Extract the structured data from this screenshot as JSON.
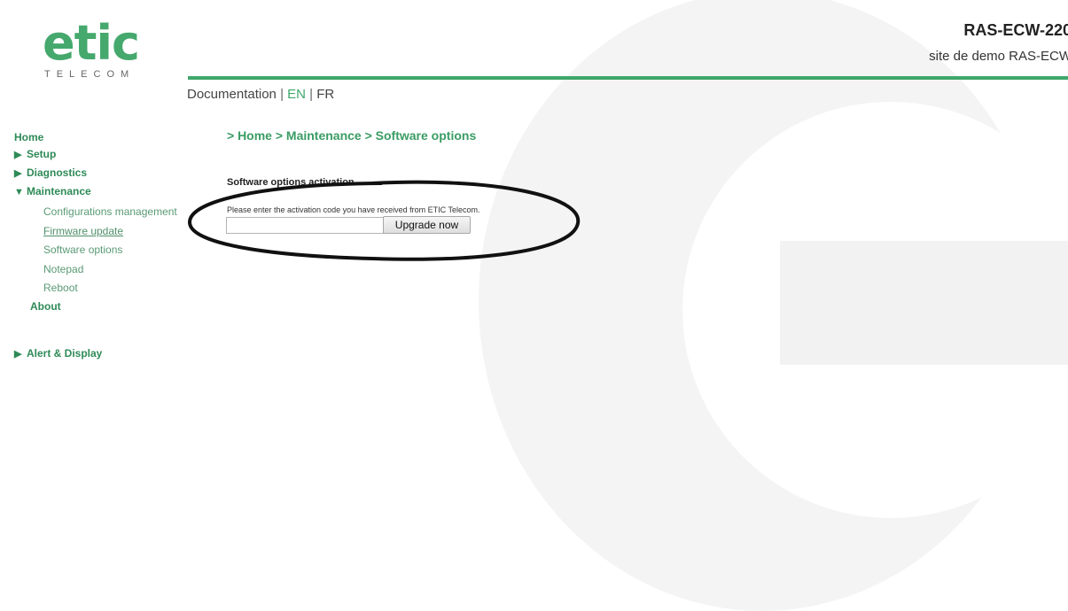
{
  "logo": {
    "word": "etic",
    "subtitle": "TELECOM"
  },
  "header": {
    "device_name": "RAS-ECW-220",
    "site_name": "site de demo RAS-ECW",
    "doc_link": "Documentation",
    "sep1": "|",
    "lang_en": "EN",
    "sep2": "|",
    "lang_fr": "FR"
  },
  "sidebar": {
    "home": "Home",
    "setup": "Setup",
    "diagnostics": "Diagnostics",
    "maintenance": "Maintenance",
    "maintenance_items": [
      "Configurations management",
      "Firmware update",
      "Software options",
      "Notepad",
      "Reboot"
    ],
    "about": "About",
    "alert_display": "Alert & Display"
  },
  "main": {
    "breadcrumb": "> Home > Maintenance > Software options",
    "section_title": "Software options activation",
    "instruction": "Please enter the activation code you have received from ETIC Telecom.",
    "code_value": "",
    "upgrade_label": "Upgrade now"
  },
  "colors": {
    "brand_green": "#3ea76a",
    "link_green": "#2e8a57"
  }
}
